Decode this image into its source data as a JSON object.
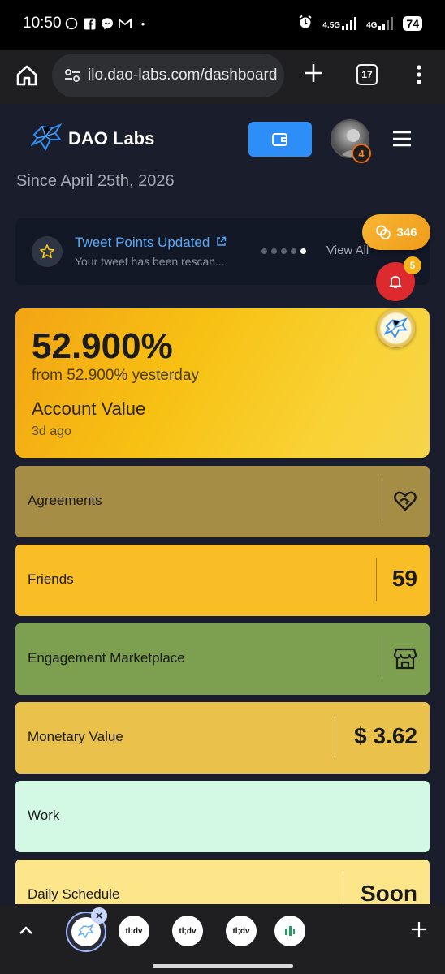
{
  "status_bar": {
    "time": "10:50",
    "notification_icons": [
      "whatsapp-icon",
      "facebook-icon",
      "messenger-icon",
      "gmail-icon"
    ],
    "dot": "•",
    "network_1": "4.5G",
    "network_2": "4G",
    "battery": "74"
  },
  "browser": {
    "url": "ilo.dao-labs.com/dashboard",
    "tab_count": "17"
  },
  "header": {
    "brand": "DAO Labs",
    "avatar_badge": "4"
  },
  "since_text": "Since April 25th, 2026",
  "ticker": {
    "title": "Tweet Points Updated",
    "subtitle": "Your tweet has been rescan...",
    "view_all": "View All",
    "dots_total": 5,
    "active_dot": 5
  },
  "floating": {
    "points": "346",
    "notifications": "5"
  },
  "account": {
    "percent": "52.900%",
    "from_text": "from 52.900% yesterday",
    "label": "Account Value",
    "time": "3d ago"
  },
  "rows": [
    {
      "label": "Agreements",
      "value": "",
      "icon": "handshake-heart-icon",
      "color": "#a58d45"
    },
    {
      "label": "Friends",
      "value": "59",
      "icon": "",
      "color": "#f9bd25"
    },
    {
      "label": "Engagement Marketplace",
      "value": "",
      "icon": "store-icon",
      "color": "#7d9f50"
    },
    {
      "label": "Monetary Value",
      "value": "$ 3.62",
      "icon": "",
      "color": "#e9c14b"
    },
    {
      "label": "Work",
      "value": "",
      "icon": "",
      "color": "#d3f8e4"
    },
    {
      "label": "Daily Schedule",
      "value": "Soon",
      "icon": "",
      "color": "#fde68a"
    }
  ],
  "bottom_tabs": [
    "tl;dv",
    "tl;dv",
    "tl;dv"
  ],
  "colors": {
    "page_bg": "#1a1d2b",
    "accent_blue": "#2e8ef8",
    "bell_red": "#dd2a2f",
    "points_orange": "#f7b733"
  }
}
